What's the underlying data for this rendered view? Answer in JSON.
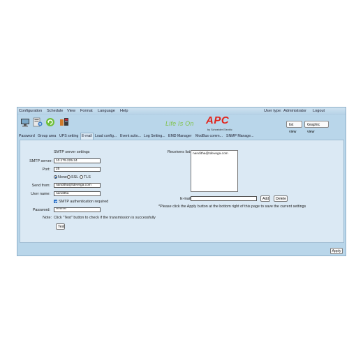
{
  "menu": [
    "Configuration",
    "Schedule",
    "View",
    "Format",
    "Language",
    "Help"
  ],
  "user": {
    "type_label": "User type:",
    "type_value": "Administrator",
    "logout": "Logout"
  },
  "toolbar": {
    "icons": [
      "monitor-icon",
      "settings-device-icon",
      "refresh-icon",
      "network-icon"
    ]
  },
  "brand": {
    "slogan": "Life Is On",
    "logo": "APC",
    "logo_sub": "by Schneider Electric"
  },
  "view_buttons": {
    "list": "list view",
    "graphic": "Graphic view"
  },
  "tabs": [
    "Password",
    "Group area",
    "UPS setting",
    "E-mail",
    "Load config...",
    "Event actio...",
    "Log Setting...",
    "EMD Manager",
    "ModBus comm...",
    "SNMP Manage..."
  ],
  "active_tab": "E-mail",
  "smtp": {
    "section_title": "SMTP server settings",
    "server_label": "SMTP server:",
    "server_value": "10.179.225.24",
    "port_label": "Port:",
    "port_value": "25",
    "security_options": [
      "None",
      "SSL",
      "TLS"
    ],
    "security_selected": "None",
    "send_from_label": "Send from:",
    "send_from_value": "nanditha@tdevega.com",
    "username_label": "User name:",
    "username_value": "nanditha",
    "auth_label": "SMTP authentication required",
    "auth_checked": true,
    "password_label": "Password:",
    "password_value": "********",
    "note_label": "Note:",
    "note_text": "Click \"Test\" button to check if the transmission is successfully",
    "test_button": "Test"
  },
  "receivers": {
    "label": "Receivers list:",
    "items": [
      "nanditha@tdevega.com"
    ],
    "email_label": "E-mail:",
    "email_value": "",
    "add_button": "Add",
    "delete_button": "Delete",
    "apply_note": "*Please click the Apply button at the bottom right of this page to save the current settings"
  },
  "apply_button": "Apply",
  "colors": {
    "accent_red": "#e2231a",
    "slogan_green": "#7fc24b",
    "panel_bg": "#dbe9f4",
    "frame_bg": "#b9d6ea"
  }
}
